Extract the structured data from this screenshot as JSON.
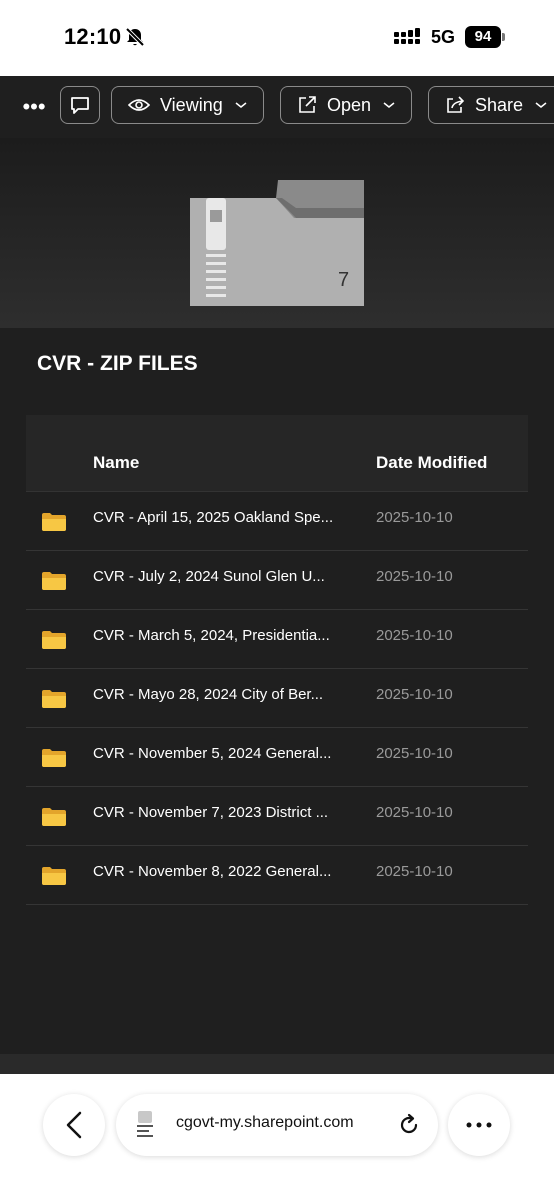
{
  "status_bar": {
    "time": "12:10",
    "network": "5G",
    "battery": "94"
  },
  "toolbar": {
    "viewing_label": "Viewing",
    "open_label": "Open",
    "share_label": "Share"
  },
  "hero": {
    "item_count": "7"
  },
  "folder": {
    "title": "CVR - ZIP FILES"
  },
  "table": {
    "columns": [
      "Name",
      "Date Modified"
    ],
    "rows": [
      {
        "name": "CVR - April 15, 2025 Oakland Spe...",
        "date": "2025-10-10"
      },
      {
        "name": "CVR - July 2, 2024 Sunol Glen U...",
        "date": "2025-10-10"
      },
      {
        "name": "CVR - March 5, 2024, Presidentia...",
        "date": "2025-10-10"
      },
      {
        "name": "CVR - Mayo 28, 2024 City of Ber...",
        "date": "2025-10-10"
      },
      {
        "name": "CVR - November 5, 2024 General...",
        "date": "2025-10-10"
      },
      {
        "name": "CVR - November 7, 2023 District ...",
        "date": "2025-10-10"
      },
      {
        "name": "CVR - November 8, 2022 General...",
        "date": "2025-10-10"
      }
    ]
  },
  "browser": {
    "url": "cgovt-my.sharepoint.com"
  },
  "colors": {
    "folder_yellow": "#f7c744",
    "app_background": "#1f1f1f"
  },
  "icons": [
    "bell-slash-icon",
    "signal-icon",
    "more-icon",
    "comment-icon",
    "eye-icon",
    "open-external-icon",
    "share-icon",
    "chevron-down-icon",
    "zip-folder-icon",
    "folder-icon",
    "back-arrow-icon",
    "reader-icon",
    "reload-icon"
  ]
}
